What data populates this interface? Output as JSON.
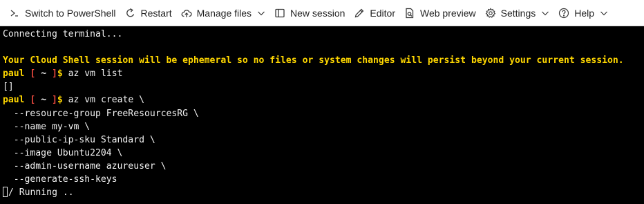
{
  "toolbar": {
    "items": [
      {
        "label": "Switch to PowerShell",
        "icon": "terminal-switch-icon"
      },
      {
        "label": "Restart",
        "icon": "restart-icon"
      },
      {
        "label": "Manage files",
        "icon": "cloud-upload-icon"
      },
      {
        "label": "New session",
        "icon": "new-session-icon"
      },
      {
        "label": "Editor",
        "icon": "pencil-icon"
      },
      {
        "label": "Web preview",
        "icon": "web-preview-icon"
      },
      {
        "label": "Settings",
        "icon": "gear-icon"
      },
      {
        "label": "Help",
        "icon": "help-icon"
      }
    ]
  },
  "terminal": {
    "connecting": "Connecting terminal...",
    "warning": "Your Cloud Shell session will be ephemeral so no files or system changes will persist beyond your current session.",
    "prompt": {
      "user": "paul",
      "open": " [ ",
      "dir": "~",
      "close": " ]",
      "dollar": "$"
    },
    "cmd1": " az vm list",
    "output1": "[]",
    "cmd2": " az vm create \\",
    "args": [
      "  --resource-group FreeResourcesRG \\",
      "  --name my-vm \\",
      "  --public-ip-sku Standard \\",
      "  --image Ubuntu2204 \\",
      "  --admin-username azureuser \\",
      "  --generate-ssh-keys"
    ],
    "status": "/ Running .."
  },
  "colors": {
    "terminal_bg": "#000000",
    "terminal_fg": "#f2f2f2",
    "warning": "#ffd700",
    "bracket": "#e5473c",
    "toolbar_bg": "#ffffff"
  }
}
